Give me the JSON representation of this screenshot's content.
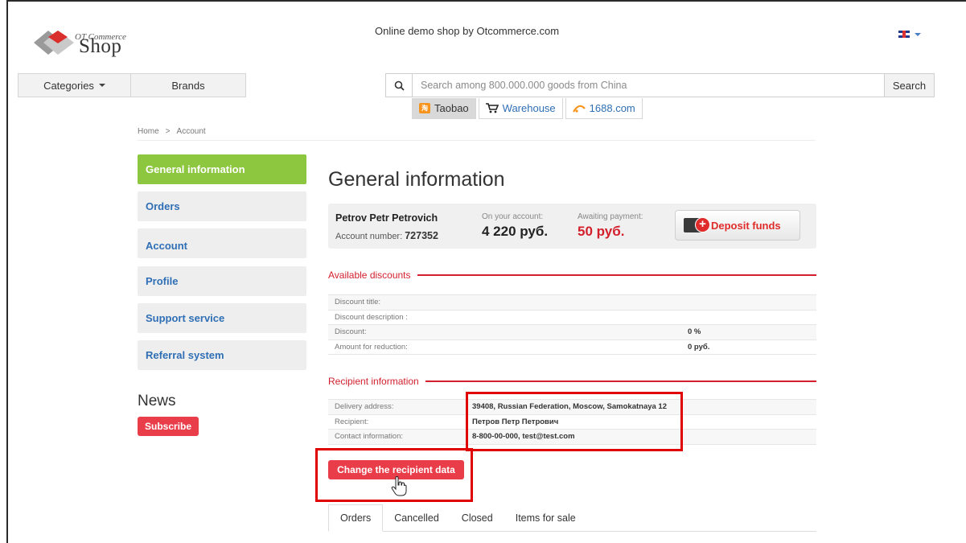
{
  "header": {
    "logo_top": "OT Commerce",
    "logo_main": "Shop",
    "tagline": "Online demo shop by Otcommerce.com"
  },
  "nav": {
    "categories": "Categories",
    "brands": "Brands"
  },
  "search": {
    "placeholder": "Search among 800.000.000 goods from China",
    "button": "Search",
    "sources": [
      {
        "label": "Taobao",
        "icon": "taobao-icon"
      },
      {
        "label": "Warehouse",
        "icon": "cart-icon"
      },
      {
        "label": "1688.com",
        "icon": "1688-icon"
      }
    ]
  },
  "breadcrumb": {
    "home": "Home",
    "sep": ">",
    "current": "Account"
  },
  "sidebar": {
    "items": [
      {
        "label": "General information"
      },
      {
        "label": "Orders"
      },
      {
        "label": "Account"
      },
      {
        "label": "Profile"
      },
      {
        "label": "Support service"
      },
      {
        "label": "Referral system"
      }
    ],
    "news_title": "News",
    "subscribe": "Subscribe"
  },
  "main": {
    "title": "General information",
    "account": {
      "name": "Petrov Petr Petrovich",
      "number_label": "Account number:",
      "number": "727352",
      "balance_label": "On your account:",
      "balance": "4 220 руб.",
      "awaiting_label": "Awaiting payment:",
      "awaiting": "50 руб.",
      "deposit_button": "Deposit funds"
    },
    "discounts": {
      "heading": "Available discounts",
      "rows": [
        {
          "label": "Discount title:",
          "value": ""
        },
        {
          "label": "Discount description :",
          "value": ""
        },
        {
          "label": "Discount:",
          "value": "0 %"
        },
        {
          "label": "Amount for reduction:",
          "value": "0 руб."
        }
      ]
    },
    "recipient": {
      "heading": "Recipient information",
      "rows": [
        {
          "label": "Delivery address:",
          "value": "39408, Russian Federation, Moscow, Samokatnaya 12"
        },
        {
          "label": "Recipient:",
          "value": "Петров Петр Петрович"
        },
        {
          "label": "Contact information:",
          "value": "8-800-00-000, test@test.com"
        }
      ],
      "change_button": "Change the recipient data"
    },
    "tabs": [
      "Orders",
      "Cancelled",
      "Closed",
      "Items for sale"
    ]
  },
  "colors": {
    "accent_green": "#8dc63f",
    "link_blue": "#2f6fb5",
    "alert_red": "#d31f2c",
    "button_red": "#e93d4a",
    "highlight_red": "#e00000"
  }
}
